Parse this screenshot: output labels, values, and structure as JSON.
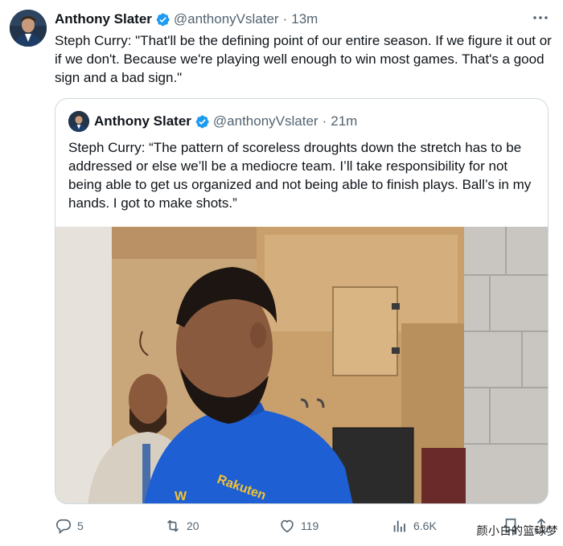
{
  "tweet": {
    "author_name": "Anthony Slater",
    "author_handle": "@anthonyVslater",
    "separator": "·",
    "time": "13m",
    "text": "Steph Curry: \"That'll be the defining point of our entire season. If we figure it out or if we don't. Because we're playing well enough to win most games. That's a good sign and a bad sign.\""
  },
  "quoted": {
    "author_name": "Anthony Slater",
    "author_handle": "@anthonyVslater",
    "separator": "·",
    "time": "21m",
    "text": "Steph Curry: “The pattern of scoreless droughts down the stretch has to be addressed or else we’ll be a mediocre team. I’ll take responsibility for not being able to get us organized and not being able to finish plays. Ball’s in my hands. I got to make shots.”",
    "photo": {
      "shirt_text": "Rakuten"
    }
  },
  "actions": {
    "replies": "5",
    "reposts": "20",
    "likes": "119",
    "views": "6.6K"
  },
  "watermark": "颜小白的篮球梦",
  "colors": {
    "verified": "#1d9bf0",
    "muted": "#536471",
    "border": "#cfd9de",
    "jersey": "#1a56c9"
  },
  "icons": [
    "verified-badge-icon",
    "more-icon",
    "reply-icon",
    "repost-icon",
    "like-icon",
    "views-icon",
    "bookmark-icon",
    "share-icon"
  ]
}
